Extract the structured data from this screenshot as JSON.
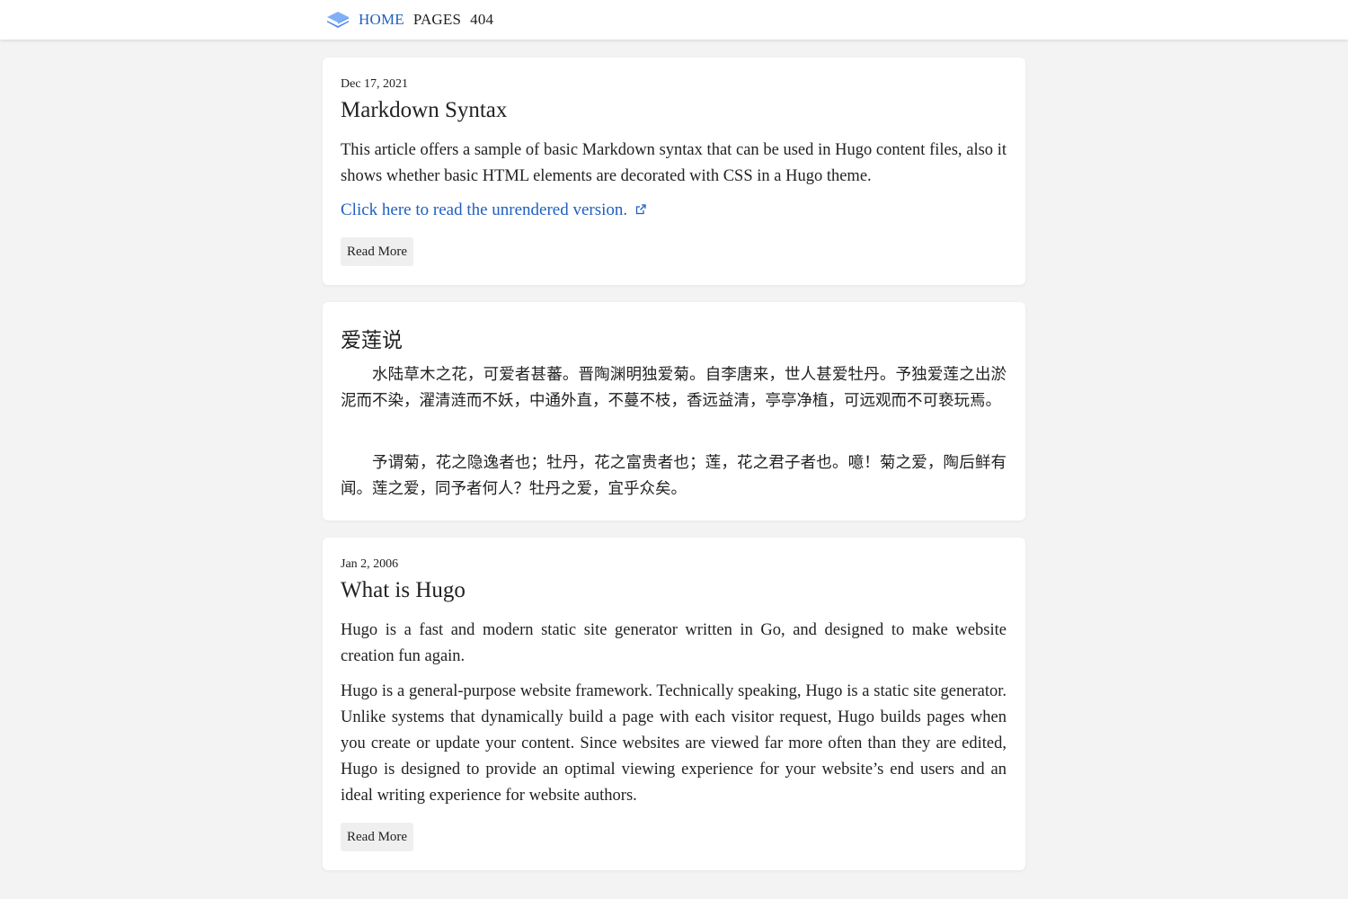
{
  "nav": {
    "logo_icon": "layers-icon",
    "items": [
      {
        "label": "HOME",
        "active": true
      },
      {
        "label": "PAGES",
        "active": false
      },
      {
        "label": "404",
        "active": false
      }
    ],
    "active_color": "#1f5fbf"
  },
  "posts": [
    {
      "date": "Dec 17, 2021",
      "title": "Markdown Syntax",
      "paragraphs": [
        "This article offers a sample of basic Markdown syntax that can be used in Hugo content files, also it shows whether basic HTML elements are decorated with CSS in a Hugo theme."
      ],
      "link_text": "Click here to read the unrendered version.",
      "link_icon": "external-link-icon",
      "button": "Read More"
    },
    {
      "title": "爱莲说",
      "paragraphs": [
        "水陆草木之花，可爱者甚蕃。晋陶渊明独爱菊。自李唐来，世人甚爱牡丹。予独爱莲之出淤泥而不染，濯清涟而不妖，中通外直，不蔓不枝，香远益清，亭亭净植，可远观而不可亵玩焉。",
        "予谓菊，花之隐逸者也；牡丹，花之富贵者也；莲，花之君子者也。噫！菊之爱，陶后鲜有闻。莲之爱，同予者何人？牡丹之爱，宜乎众矣。"
      ]
    },
    {
      "date": "Jan 2, 2006",
      "title": "What is Hugo",
      "paragraphs": [
        "Hugo is a fast and modern static site generator written in Go, and designed to make website creation fun again.",
        "Hugo is a general-purpose website framework. Technically speaking, Hugo is a static site generator. Unlike systems that dynamically build a page with each visitor request, Hugo builds pages when you create or update your content. Since websites are viewed far more often than they are edited, Hugo is designed to provide an optimal viewing experience for your website’s end users and an ideal writing experience for website authors."
      ],
      "button": "Read More"
    }
  ]
}
